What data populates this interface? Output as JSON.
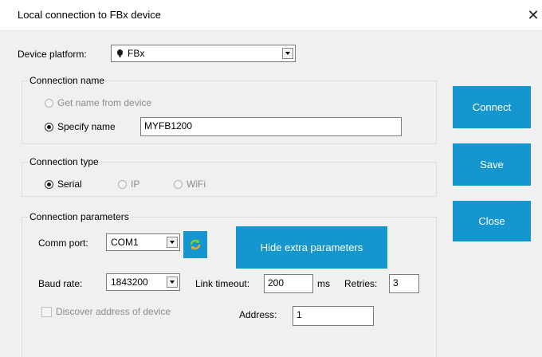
{
  "window": {
    "title": "Local connection to FBx device",
    "close_glyph": "✕"
  },
  "device_platform": {
    "label": "Device platform:",
    "value": "FBx",
    "icon": "fbx-device-icon"
  },
  "connection_name": {
    "group_title": "Connection name",
    "option_from_device": "Get name from device",
    "option_specify": "Specify name",
    "selected": "specify",
    "name_value": "MYFB1200"
  },
  "connection_type": {
    "group_title": "Connection type",
    "options": [
      "Serial",
      "IP",
      "WiFi"
    ],
    "selected": "Serial"
  },
  "connection_parameters": {
    "group_title": "Connection parameters",
    "comm_port_label": "Comm port:",
    "comm_port_value": "COM1",
    "refresh_icon": "refresh-icon",
    "hide_extra_label": "Hide extra parameters",
    "baud_rate_label": "Baud rate:",
    "baud_rate_value": "1843200",
    "link_timeout_label": "Link timeout:",
    "link_timeout_value": "200",
    "link_timeout_unit": "ms",
    "retries_label": "Retries:",
    "retries_value": "3",
    "discover_label": "Discover address of device",
    "address_label": "Address:",
    "address_value": "1"
  },
  "actions": {
    "connect": "Connect",
    "save": "Save",
    "close": "Close"
  },
  "colors": {
    "accent": "#1596cf",
    "dialog_bg": "#f0f0f0"
  }
}
